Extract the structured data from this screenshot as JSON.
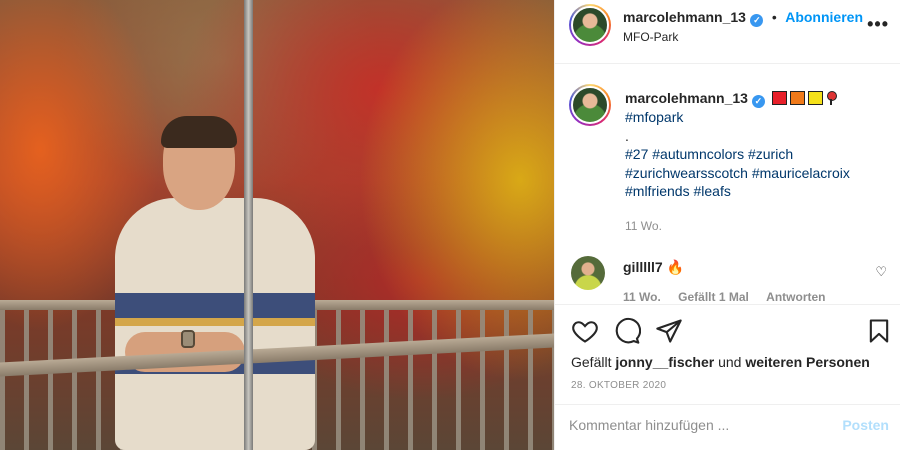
{
  "post": {
    "username": "marcolehmann_13",
    "follow_label": "Abonnieren",
    "separator": "•",
    "location": "MFO-Park",
    "more_label": "•••"
  },
  "caption": {
    "username": "marcolehmann_13",
    "flag_colors": [
      "#e8202a",
      "#f07a1a",
      "#f5e11a"
    ],
    "line1": "#mfopark",
    "line2": ".",
    "hashtags": [
      "#27",
      "#autumncolors",
      "#zurich",
      "#zurichwearsscotch",
      "#mauricelacroix",
      "#mlfriends",
      "#leafs"
    ],
    "time": "11 Wo."
  },
  "comment": {
    "username": "gilllll7",
    "emoji": "🔥",
    "time": "11 Wo.",
    "likes": "Gefällt 1 Mal",
    "reply_label": "Antworten"
  },
  "actions": {
    "liked_prefix": "Gefällt",
    "liked_user": "jonny__fischer",
    "liked_middle": "und",
    "liked_rest": "weiteren Personen",
    "date": "28. Oktober 2020"
  },
  "comment_box": {
    "placeholder": "Kommentar hinzufügen ...",
    "post_label": "Posten"
  },
  "colors": {
    "accent": "#0095f6",
    "hashtag": "#00376b",
    "muted": "#8e8e8e"
  }
}
